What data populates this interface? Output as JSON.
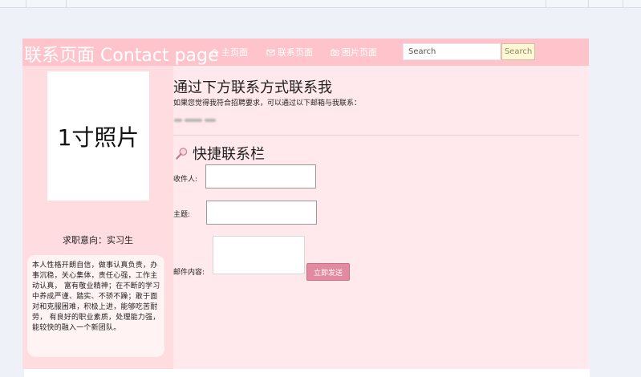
{
  "header": {
    "brand": "联系页面 Contact page",
    "nav": [
      {
        "label": "主页面",
        "icon": "home-icon"
      },
      {
        "label": "联系页面",
        "icon": "mail-icon"
      },
      {
        "label": "图片页面",
        "icon": "image-icon"
      }
    ],
    "search": {
      "placeholder": "Search",
      "button_label": "Search"
    }
  },
  "sidebar": {
    "photo_label": "1寸照片",
    "objective": "求职意向：实习生",
    "intro": "本人性格开朗自信，做事认真负责，办事沉稳，关心集体，责任心强，工作主动认真， 富有敬业精神；在不断的学习中养成严谨、踏实、不骄不躁；敢于面对和克服困难，积极上进，能够吃苦耐劳， 有良好的职业素质，处理能力强，能较快的融入一个新团队。"
  },
  "main": {
    "title": "通过下方联系方式联系我",
    "description": "如果您觉得我符合招聘要求，可以通过以下邮箱与我联系：",
    "quick_contact": {
      "title": "快捷联系栏",
      "icon": "magnifier-icon",
      "recipient_label": "收件人:",
      "subject_label": "主题:",
      "content_label": "邮件内容:",
      "send_label": "立即发送"
    }
  },
  "colors": {
    "header_bg": "#ffc4cb",
    "page_bg": "#ffe9ec",
    "sidebar_bg": "#ffdcdf",
    "send_button": "#e28a9f"
  }
}
